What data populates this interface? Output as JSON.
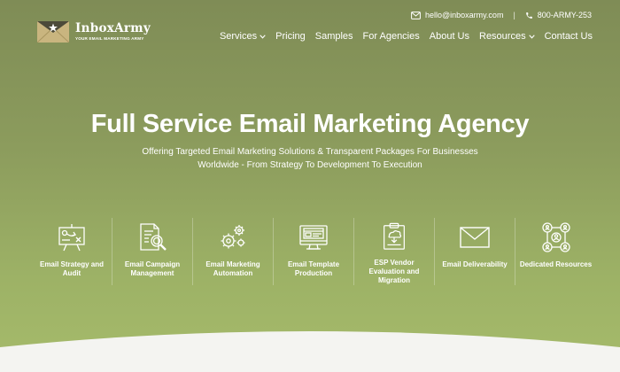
{
  "topbar": {
    "email": "hello@inboxarmy.com",
    "separator": "|",
    "phone": "800-ARMY-253"
  },
  "logo": {
    "name": "InboxArmy",
    "tagline": "YOUR EMAIL MARKETING ARMY"
  },
  "nav": {
    "items": [
      {
        "label": "Services",
        "dropdown": true
      },
      {
        "label": "Pricing",
        "dropdown": false
      },
      {
        "label": "Samples",
        "dropdown": false
      },
      {
        "label": "For Agencies",
        "dropdown": false
      },
      {
        "label": "About Us",
        "dropdown": false
      },
      {
        "label": "Resources",
        "dropdown": true
      },
      {
        "label": "Contact Us",
        "dropdown": false
      }
    ]
  },
  "hero": {
    "title": "Full Service Email Marketing Agency",
    "subtitle_line1": "Offering Targeted Email Marketing Solutions & Transparent Packages For Businesses",
    "subtitle_line2": "Worldwide - From Strategy To Development To Execution"
  },
  "services": [
    {
      "label": "Email Strategy and Audit",
      "icon": "strategy-board-icon"
    },
    {
      "label": "Email Campaign Management",
      "icon": "document-magnifier-icon"
    },
    {
      "label": "Email Marketing Automation",
      "icon": "gears-icon"
    },
    {
      "label": "Email Template Production",
      "icon": "monitor-template-icon"
    },
    {
      "label": "ESP Vendor Evaluation and Migration",
      "icon": "clipboard-cloud-icon"
    },
    {
      "label": "Email Deliverability",
      "icon": "envelope-icon"
    },
    {
      "label": "Dedicated Resources",
      "icon": "team-network-icon"
    }
  ],
  "colors": {
    "background_top": "#7f8c56",
    "background_bottom": "#a6bb6b",
    "logo_envelope": "#c9b57f",
    "text": "#ffffff"
  }
}
